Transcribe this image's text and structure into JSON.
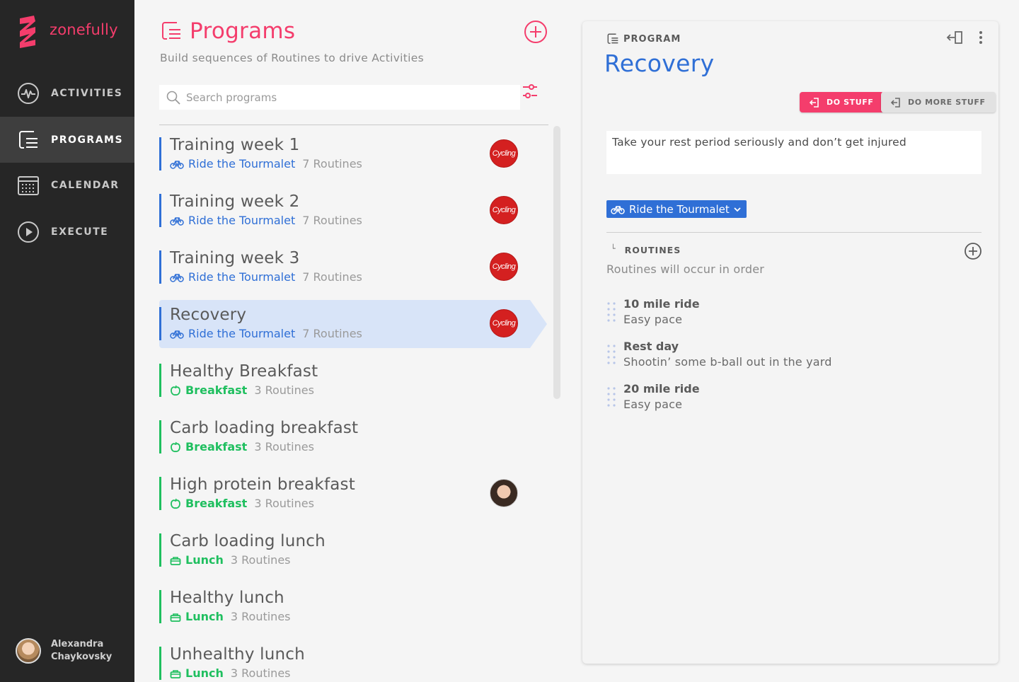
{
  "app": {
    "name": "zonefully"
  },
  "nav": {
    "items": [
      {
        "label": "ACTIVITIES",
        "icon": "pulse-icon"
      },
      {
        "label": "PROGRAMS",
        "icon": "programs-icon",
        "active": true
      },
      {
        "label": "CALENDAR",
        "icon": "calendar-icon"
      },
      {
        "label": "EXECUTE",
        "icon": "play-icon"
      }
    ]
  },
  "user": {
    "first_name": "Alexandra",
    "last_name": "Chaykovsky"
  },
  "page": {
    "title": "Programs",
    "subtitle": "Build sequences of Routines to drive Activities",
    "search_placeholder": "Search programs"
  },
  "programs": [
    {
      "name": "Training week 1",
      "tag": "Ride the Tourmalet",
      "count": "7 Routines",
      "badge": "Cycling",
      "kind": "cycling"
    },
    {
      "name": "Training week 2",
      "tag": "Ride the Tourmalet",
      "count": "7 Routines",
      "badge": "Cycling",
      "kind": "cycling"
    },
    {
      "name": "Training week 3",
      "tag": "Ride the Tourmalet",
      "count": "7 Routines",
      "badge": "Cycling",
      "kind": "cycling"
    },
    {
      "name": "Recovery",
      "tag": "Ride the Tourmalet",
      "count": "7 Routines",
      "badge": "Cycling",
      "kind": "cycling",
      "selected": true
    },
    {
      "name": "Healthy Breakfast",
      "tag": "Breakfast",
      "count": "3 Routines",
      "kind": "breakfast"
    },
    {
      "name": "Carb loading breakfast",
      "tag": "Breakfast",
      "count": "3 Routines",
      "kind": "breakfast"
    },
    {
      "name": "High protein breakfast",
      "tag": "Breakfast",
      "count": "3 Routines",
      "kind": "breakfast",
      "photo": true
    },
    {
      "name": "Carb loading lunch",
      "tag": "Lunch",
      "count": "3 Routines",
      "kind": "lunch"
    },
    {
      "name": "Healthy lunch",
      "tag": "Lunch",
      "count": "3 Routines",
      "kind": "lunch"
    },
    {
      "name": "Unhealthy lunch",
      "tag": "Lunch",
      "count": "3 Routines",
      "kind": "lunch"
    }
  ],
  "detail": {
    "kicker": "PROGRAM",
    "title": "Recovery",
    "primary_action": "DO STUFF",
    "secondary_action": "DO MORE STUFF",
    "description": "Take your rest period seriously and don’t get injured",
    "selected_goal": "Ride the Tourmalet",
    "routines_heading": "ROUTINES",
    "routines_subtitle": "Routines will occur in order",
    "routines": [
      {
        "title": "10 mile ride",
        "subtitle": "Easy pace"
      },
      {
        "title": "Rest day",
        "subtitle": "Shootin’ some b-ball out in the yard"
      },
      {
        "title": "20 mile ride",
        "subtitle": "Easy pace"
      }
    ]
  },
  "colors": {
    "accent": "#f43d6c",
    "blue": "#2f6fd6",
    "green": "#1fbf5f",
    "sidebar": "#262626"
  }
}
